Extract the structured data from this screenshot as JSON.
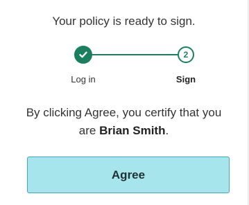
{
  "headline": "Your policy is ready to sign.",
  "stepper": {
    "steps": [
      {
        "label": "Log in",
        "state": "complete",
        "icon": "check-icon"
      },
      {
        "label": "Sign",
        "state": "current",
        "number": "2"
      }
    ],
    "accent_color": "#1a7f5e"
  },
  "certify": {
    "line1": "By clicking Agree, you certify that you",
    "prefix": "are ",
    "name": "Brian Smith",
    "suffix": "."
  },
  "agree_button": {
    "label": "Agree",
    "background": "#a7e5ec",
    "border": "#3fa9bd"
  }
}
